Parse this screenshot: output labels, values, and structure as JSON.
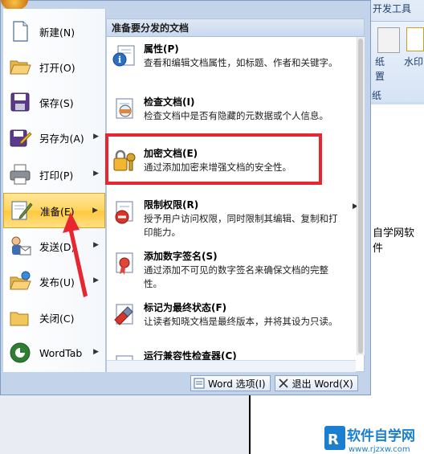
{
  "background": {
    "ribbon_tab": "开发工具",
    "ribbon_btn1_text": [
      "纸",
      "置"
    ],
    "ribbon_btn2_text": "水印",
    "ribbon_group_tail": "纸",
    "doc_text": "自学网软件",
    "watermark_text": "软件自学网",
    "watermark_url": "www.rjzxw.com"
  },
  "left_menu": {
    "items": [
      {
        "label": "新建(N)",
        "icon": "new-doc-icon"
      },
      {
        "label": "打开(O)",
        "icon": "open-folder-icon"
      },
      {
        "label": "保存(S)",
        "icon": "save-disk-icon"
      },
      {
        "label": "另存为(A)",
        "icon": "save-as-icon",
        "has_submenu": true
      },
      {
        "label": "打印(P)",
        "icon": "printer-icon",
        "has_submenu": true
      },
      {
        "label": "准备(E)",
        "icon": "prepare-icon",
        "has_submenu": true,
        "active": true
      },
      {
        "label": "发送(D)",
        "icon": "send-icon",
        "has_submenu": true
      },
      {
        "label": "发布(U)",
        "icon": "publish-icon",
        "has_submenu": true
      },
      {
        "label": "关闭(C)",
        "icon": "close-folder-icon"
      },
      {
        "label": "WordTab",
        "icon": "wordtab-icon",
        "has_submenu": true
      }
    ]
  },
  "right_pane": {
    "title": "准备要分发的文档",
    "items": [
      {
        "title": "属性(P)",
        "desc": "查看和编辑文档属性，如标题、作者和关键字。",
        "icon": "properties-icon"
      },
      {
        "title": "检查文档(I)",
        "desc": "检查文档中是否有隐藏的元数据或个人信息。",
        "icon": "inspect-icon"
      },
      {
        "title": "加密文档(E)",
        "desc": "通过添加加密来增强文档的安全性。",
        "icon": "lock-key-icon"
      },
      {
        "title": "限制权限(R)",
        "desc": "授予用户访问权限，同时限制其编辑、复制和打印能力。",
        "icon": "restrict-icon",
        "has_submenu": true
      },
      {
        "title": "添加数字签名(S)",
        "desc": "通过添加不可见的数字签名来确保文档的完整性。",
        "icon": "signature-icon"
      },
      {
        "title": "标记为最终状态(F)",
        "desc": "让读者知晓文档是最终版本，并将其设为只读。",
        "icon": "mark-final-icon"
      },
      {
        "title": "运行兼容性检查器(C)",
        "desc": "",
        "icon": "compat-icon"
      }
    ]
  },
  "bottom": {
    "options_label": "Word 选项(I)",
    "exit_label": "退出 Word(X)"
  },
  "colors": {
    "highlight": "#e8262f",
    "active_item": "#ffd45d"
  }
}
